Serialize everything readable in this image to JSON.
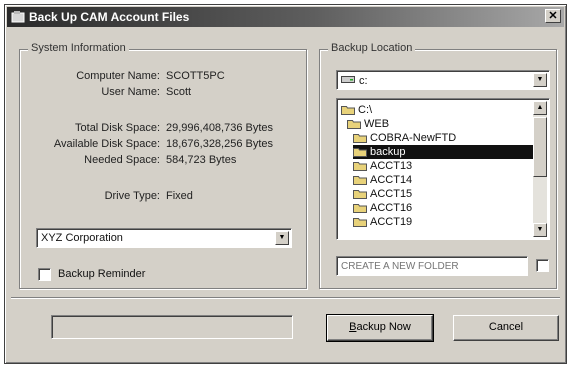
{
  "window": {
    "title": "Back Up CAM Account Files"
  },
  "system_info": {
    "group_label": "System Information",
    "fields": [
      {
        "label": "Computer Name:",
        "value": "SCOTT5PC"
      },
      {
        "label": "User Name:",
        "value": "Scott"
      },
      {
        "label": "Total Disk Space:",
        "value": "29,996,408,736 Bytes"
      },
      {
        "label": "Available Disk Space:",
        "value": "18,676,328,256 Bytes"
      },
      {
        "label": "Needed Space:",
        "value": "584,723 Bytes"
      },
      {
        "label": "Drive Type:",
        "value": "Fixed"
      }
    ],
    "company_select": "XYZ Corporation",
    "backup_reminder_label": "Backup Reminder",
    "backup_reminder_checked": false
  },
  "backup_location": {
    "group_label": "Backup Location",
    "drive_select": "c:",
    "folders": [
      {
        "name": "C:\\",
        "selected": false
      },
      {
        "name": "WEB",
        "selected": false
      },
      {
        "name": "COBRA-NewFTD",
        "selected": false
      },
      {
        "name": "backup",
        "selected": true
      },
      {
        "name": "ACCT13",
        "selected": false
      },
      {
        "name": "ACCT14",
        "selected": false
      },
      {
        "name": "ACCT15",
        "selected": false
      },
      {
        "name": "ACCT16",
        "selected": false
      },
      {
        "name": "ACCT19",
        "selected": false
      }
    ],
    "new_folder_placeholder": "CREATE A NEW FOLDER"
  },
  "footer": {
    "backup_now_accel": "B",
    "backup_now_rest": "ackup Now",
    "cancel_label": "Cancel"
  },
  "colors": {
    "face": "#d4d0c8",
    "selection": "#111111",
    "folder": "#e8d27a"
  }
}
